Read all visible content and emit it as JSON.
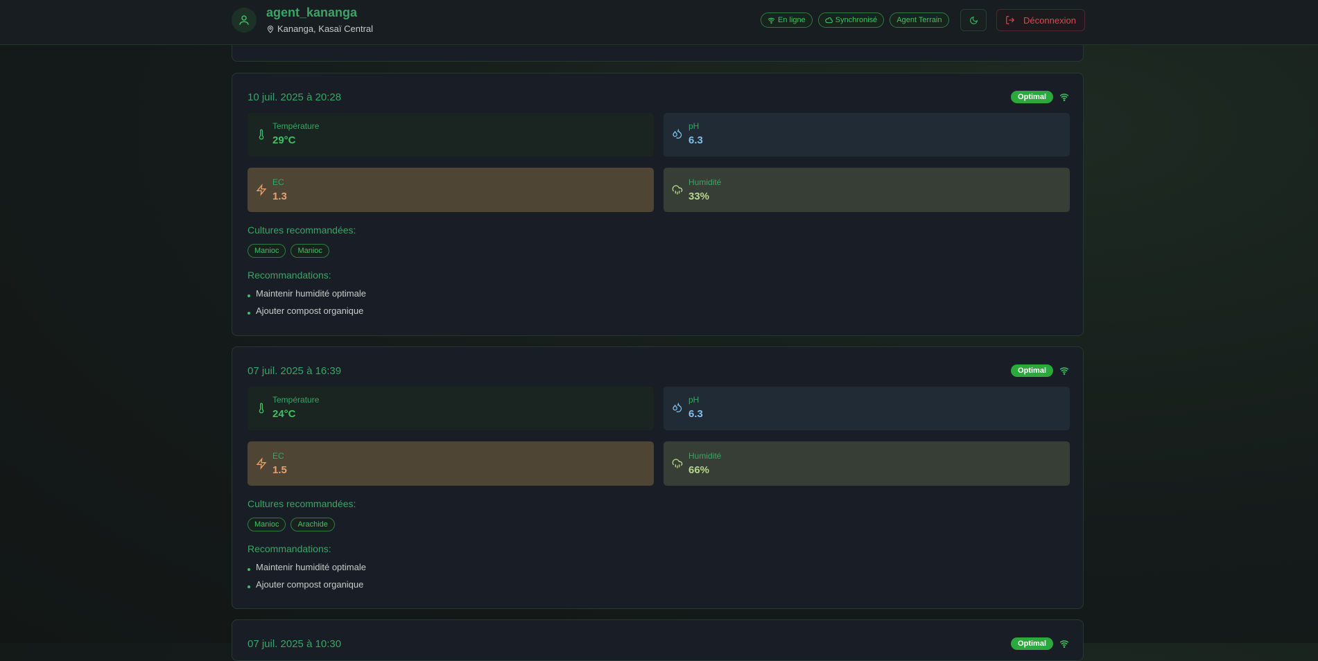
{
  "header": {
    "user_name": "agent_kananga",
    "location": "Kananga, Kasaï Central",
    "badges": {
      "online": "En ligne",
      "synced": "Synchronisé",
      "role": "Agent Terrain"
    },
    "logout_label": "Déconnexion"
  },
  "labels": {
    "temperature": "Température",
    "ph": "pH",
    "ec": "EC",
    "humidity": "Humidité",
    "cultures_title": "Cultures recommandées:",
    "recommendations_title": "Recommandations:"
  },
  "readings": [
    {
      "date": "10 juil. 2025 à 20:28",
      "status": "Optimal",
      "temperature": "29°C",
      "ph": "6.3",
      "ec": "1.3",
      "humidity": "33%",
      "cultures": [
        "Manioc",
        "Manioc"
      ],
      "recommendations": [
        "Maintenir humidité optimale",
        "Ajouter compost organique"
      ]
    },
    {
      "date": "07 juil. 2025 à 16:39",
      "status": "Optimal",
      "temperature": "24°C",
      "ph": "6.3",
      "ec": "1.5",
      "humidity": "66%",
      "cultures": [
        "Manioc",
        "Arachide"
      ],
      "recommendations": [
        "Maintenir humidité optimale",
        "Ajouter compost organique"
      ]
    },
    {
      "date": "07 juil. 2025 à 10:30",
      "status": "Optimal"
    }
  ],
  "colors": {
    "accent": "#3aa564",
    "status_green": "#2ca83d",
    "danger": "#e0464f"
  },
  "icons": [
    "user-icon",
    "map-pin-icon",
    "wifi-icon",
    "cloud-icon",
    "moon-icon",
    "logout-icon",
    "thermometer-icon",
    "droplets-icon",
    "zap-icon",
    "cloud-rain-icon"
  ]
}
